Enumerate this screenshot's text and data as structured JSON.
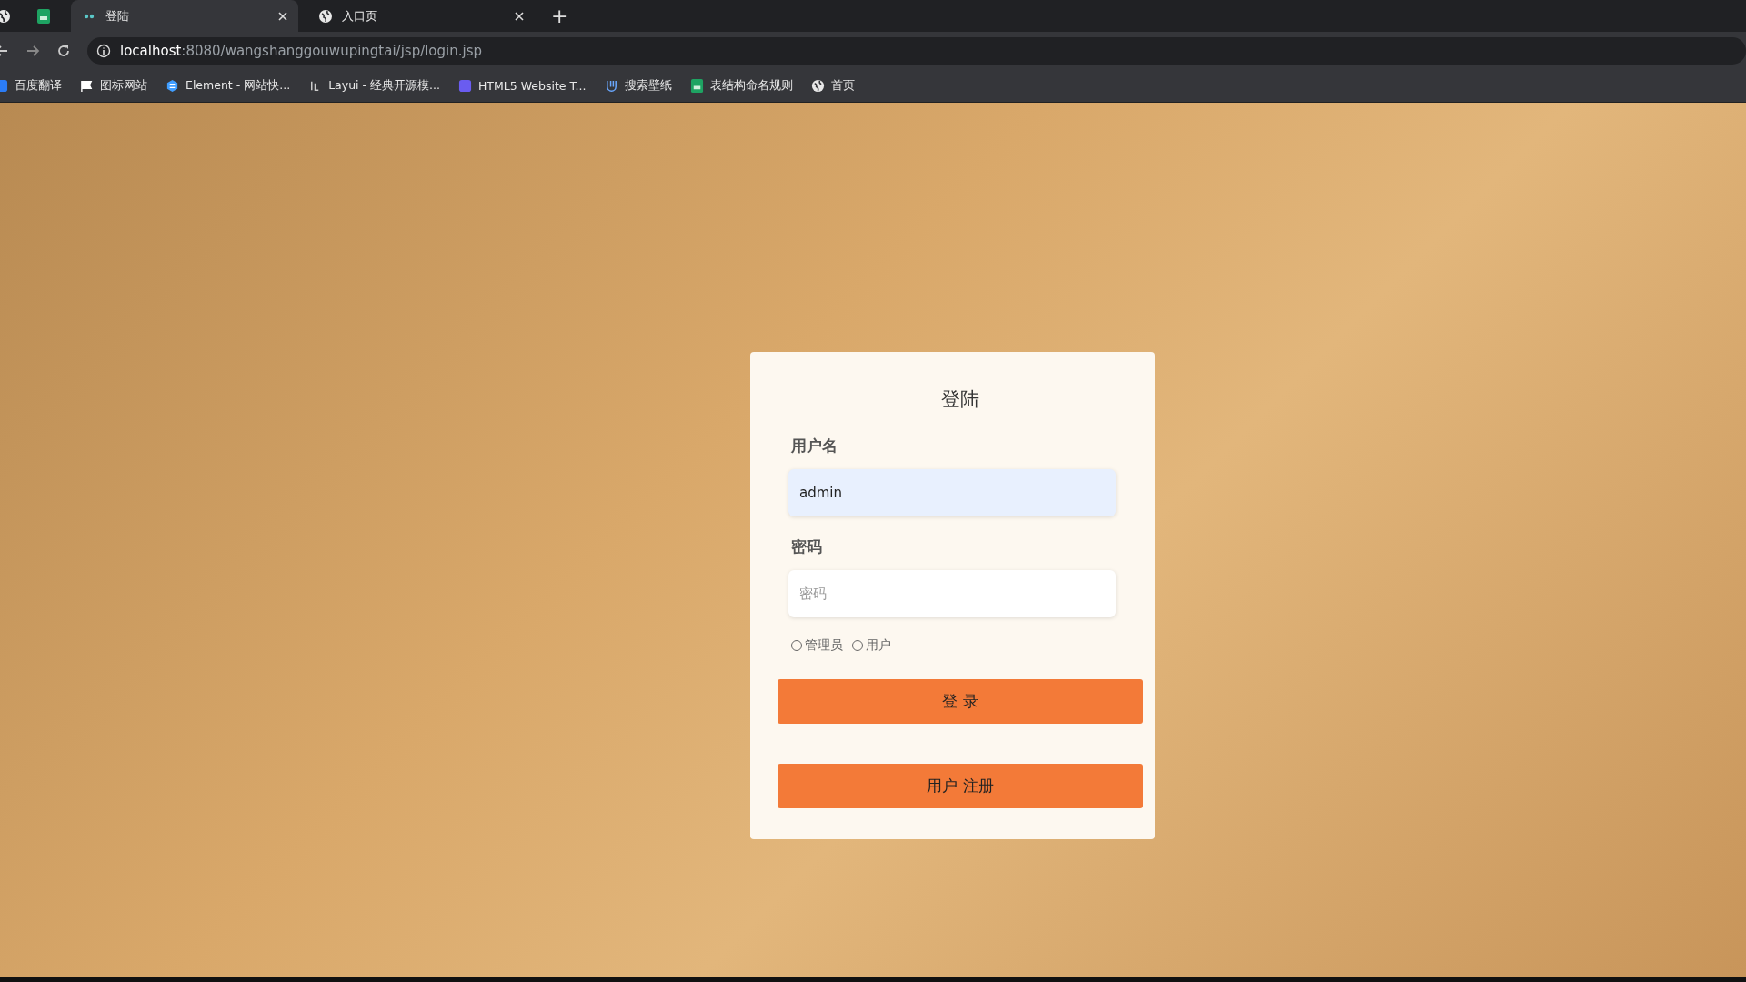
{
  "browser": {
    "tabs": [
      {
        "title": "登陆",
        "selected": true
      },
      {
        "title": "入口页",
        "selected": false
      }
    ],
    "new_tab": "+",
    "address": {
      "host": "localhost",
      "path": ":8080/wangshanggouwupingtai/jsp/login.jsp"
    },
    "bookmarks": [
      {
        "label": "百度翻译"
      },
      {
        "label": "图标网站"
      },
      {
        "label": "Element - 网站快..."
      },
      {
        "label": "Layui - 经典开源模..."
      },
      {
        "label": "HTML5 Website T..."
      },
      {
        "label": "搜索壁纸"
      },
      {
        "label": "表结构命名规则"
      },
      {
        "label": "首页"
      }
    ]
  },
  "login": {
    "title": "登陆",
    "fields": [
      {
        "label": "用户名",
        "value": "admin",
        "autofilled": true
      },
      {
        "label": "密码",
        "placeholder": "密码",
        "autofilled": false
      }
    ],
    "roles": [
      {
        "label": "管理员",
        "selected": false
      },
      {
        "label": "用户",
        "selected": false
      }
    ],
    "buttons": [
      "登 录",
      "用户 注册"
    ]
  }
}
